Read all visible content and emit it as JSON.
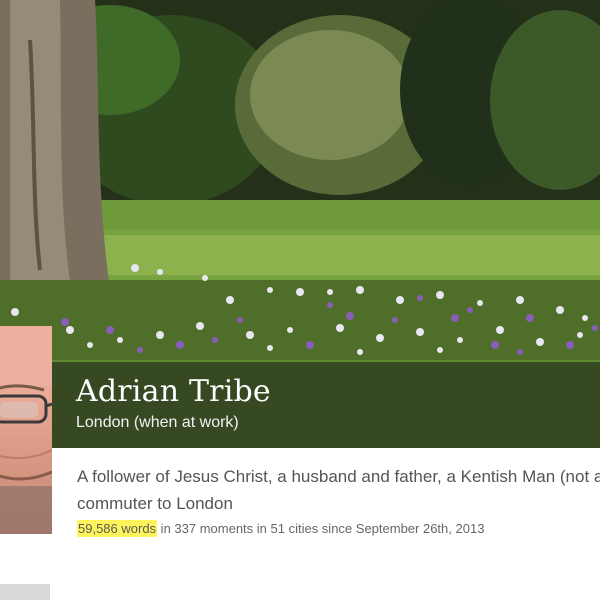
{
  "profile": {
    "name": "Adrian Tribe",
    "location": "London (when at work)",
    "bio_line1": "A follower of Jesus Christ, a husband and father, a Kentish Man (not a M",
    "bio_line2": "commuter to London",
    "stats": {
      "words": "59,586 words",
      "rest": " in 337 moments in 51 cities since September 26th, 2013"
    }
  },
  "colors": {
    "highlight": "#fff35a",
    "name_bar": "#28301e",
    "text_muted": "#555555"
  }
}
